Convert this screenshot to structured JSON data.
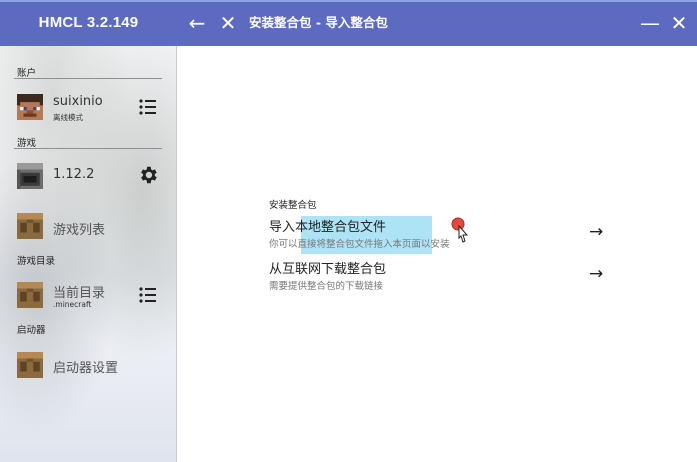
{
  "titlebar": {
    "app_title": "HMCL 3.2.149",
    "back_icon": "←",
    "close_icon": "✕",
    "page_title": "安装整合包 - 导入整合包",
    "minimize_icon": "—",
    "window_close_icon": "✕",
    "accent_color": "#5c6bc0"
  },
  "sidebar": {
    "account_section": "账户",
    "account": {
      "name": "suixinio",
      "mode": "离线模式",
      "menu_icon": "list-icon"
    },
    "game_section": "游戏",
    "game_version": {
      "name": "1.12.2",
      "settings_icon": "gear-icon"
    },
    "game_list_label": "游戏列表",
    "directory_section": "游戏目录",
    "current_directory": {
      "name": "当前目录",
      "path": ".minecraft",
      "menu_icon": "list-icon"
    },
    "launcher_section": "启动器",
    "launcher_settings_label": "启动器设置"
  },
  "main": {
    "group_title": "安装整合包",
    "options": [
      {
        "title": "导入本地整合包文件",
        "description": "你可以直接将整合包文件拖入本页面以安装",
        "arrow": "→"
      },
      {
        "title": "从互联网下载整合包",
        "description": "需要提供整合包的下载链接",
        "arrow": "→"
      }
    ],
    "highlight_color": "#aee3f5"
  }
}
